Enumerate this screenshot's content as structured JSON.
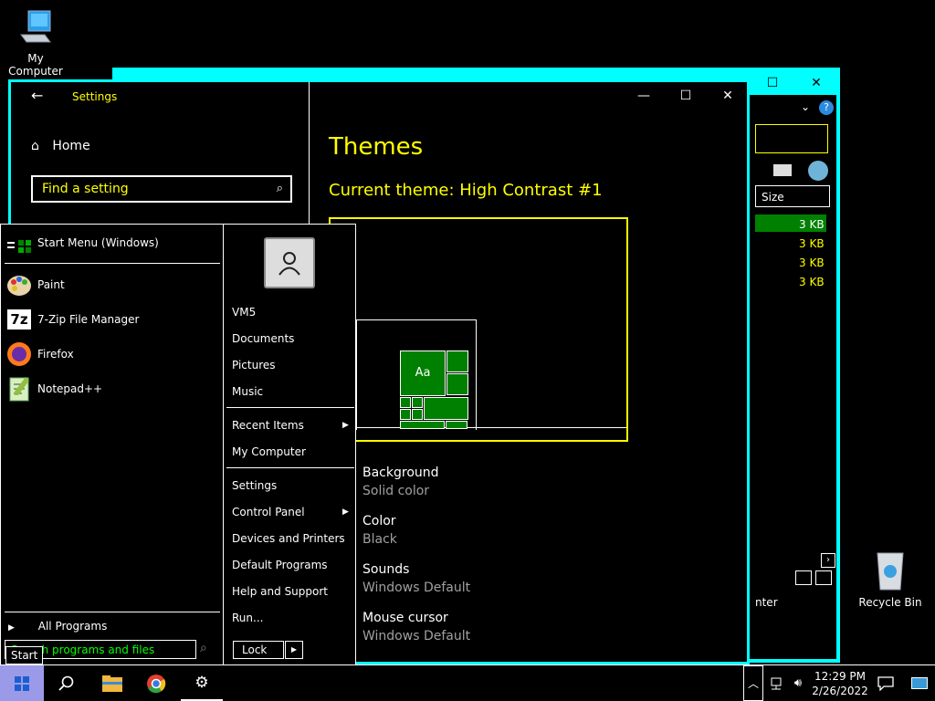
{
  "desktop": {
    "my_computer": "My Computer",
    "recycle_bin": "Recycle Bin"
  },
  "explorer": {
    "column_size": "Size",
    "sizes": [
      "3 KB",
      "3 KB",
      "3 KB",
      "3 KB"
    ],
    "status_fragment": "nter"
  },
  "settings": {
    "title": "Settings",
    "home": "Home",
    "search_placeholder": "Find a setting",
    "heading": "Themes",
    "current_theme": "Current theme: High Contrast #1",
    "preview_sample": "Aa",
    "props": [
      {
        "name": "Background",
        "value": "Solid color"
      },
      {
        "name": "Color",
        "value": "Black"
      },
      {
        "name": "Sounds",
        "value": "Windows Default"
      },
      {
        "name": "Mouse cursor",
        "value": "Windows Default"
      }
    ]
  },
  "startmenu": {
    "header": "Start Menu (Windows)",
    "pinned": [
      {
        "label": "Paint",
        "icon": "paint-icon"
      },
      {
        "label": "7-Zip File Manager",
        "icon": "7zip-icon"
      },
      {
        "label": "Firefox",
        "icon": "firefox-icon"
      },
      {
        "label": "Notepad++",
        "icon": "notepad-plus-plus-icon"
      }
    ],
    "all_programs": "All Programs",
    "search_placeholder": "Search programs and files",
    "start_tooltip": "Start",
    "right": {
      "user": "VM5",
      "documents": "Documents",
      "pictures": "Pictures",
      "music": "Music",
      "recent_items": "Recent Items",
      "my_computer": "My Computer",
      "settings": "Settings",
      "control_panel": "Control Panel",
      "devices_printers": "Devices and Printers",
      "default_programs": "Default Programs",
      "help_support": "Help and Support",
      "run": "Run...",
      "lock": "Lock"
    }
  },
  "taskbar": {
    "time": "12:29 PM",
    "date": "2/26/2022"
  },
  "colors": {
    "accent_cyan": "#00ffff",
    "accent_yellow": "#ffff00",
    "highlight_green": "#008000"
  }
}
